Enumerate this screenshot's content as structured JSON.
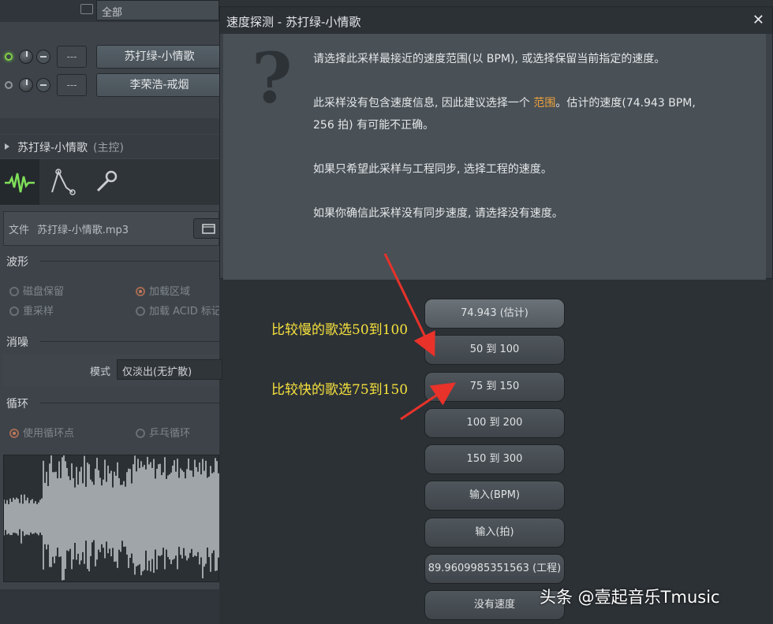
{
  "left_panel": {
    "filter_label": "全部",
    "channels": [
      {
        "value": "---",
        "name": "苏打绿-小情歌"
      },
      {
        "value": "---",
        "name": "李荣浩-戒烟"
      }
    ],
    "channel_header": "苏打绿-小情歌",
    "channel_header_suffix": "(主控)",
    "file_label": "文件",
    "file_name": "苏打绿-小情歌.mp3",
    "waveform_section": "波形",
    "waveform_options": [
      "磁盘保留",
      "加载区域",
      "重采样",
      "加载 ACID 标记"
    ],
    "declick_section": "消噪",
    "mode_label": "模式",
    "mode_value": "仅淡出(无扩散)",
    "loop_section": "循环",
    "loop_options": [
      "使用循环点",
      "乒乓循环"
    ]
  },
  "dialog": {
    "title": "速度探测 - 苏打绿-小情歌",
    "close": "✕",
    "line1": "请选择此采样最接近的速度范围(以 BPM), 或选择保留当前指定的速度。",
    "line2a": "此采样没有包含速度信息, 因此建议选择一个 ",
    "line2_link": "范围",
    "line2b": "。估计的速度(74.943 BPM,",
    "line2c": "256 拍) 有可能不正确。",
    "line3": "如果只希望此采样与工程同步, 选择工程的速度。",
    "line4": "如果你确信此采样没有同步速度, 请选择没有速度。",
    "buttons": [
      "74.943 (估计)",
      "50 到 100",
      "75 到 150",
      "100 到 200",
      "150 到 300",
      "输入(BPM)",
      "输入(拍)",
      "89.9609985351563 (工程)",
      "没有速度"
    ]
  },
  "annotations": {
    "slow": "比较慢的歌选50到100",
    "fast": "比较快的歌选75到150"
  },
  "watermark": "头条 @壹起音乐Tmusic",
  "colors": {
    "accent_orange": "#f0a33c",
    "annotation_yellow": "#f6e13c",
    "arrow_red": "#e8322a"
  }
}
